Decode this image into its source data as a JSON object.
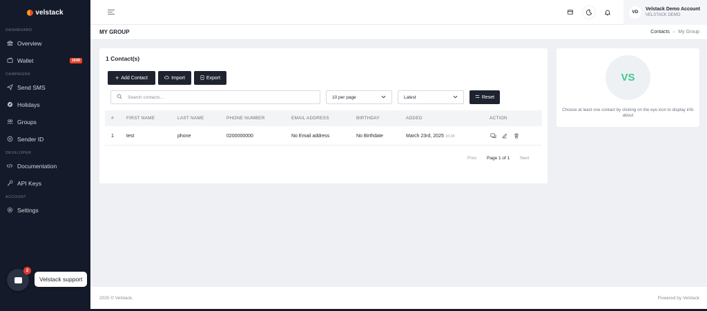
{
  "brand": {
    "name": "velstack",
    "accent": "#e8452c"
  },
  "sidebar": {
    "sections": [
      {
        "label": "DASHBOARD",
        "items": [
          {
            "label": "Overview",
            "icon": "bank-icon"
          },
          {
            "label": "Wallet",
            "icon": "wallet-icon",
            "badge": "1649"
          }
        ]
      },
      {
        "label": "CAMPAIGNS",
        "items": [
          {
            "label": "Send SMS",
            "icon": "send-icon"
          },
          {
            "label": "Holidays",
            "icon": "compass-icon"
          },
          {
            "label": "Groups",
            "icon": "users-icon"
          },
          {
            "label": "Sender ID",
            "icon": "target-icon"
          }
        ]
      },
      {
        "label": "DEVELOPER",
        "items": [
          {
            "label": "Documentation",
            "icon": "code-icon"
          },
          {
            "label": "API Keys",
            "icon": "key-icon"
          }
        ]
      },
      {
        "label": "ACCOUNT",
        "items": [
          {
            "label": "Settings",
            "icon": "gear-icon"
          }
        ]
      }
    ]
  },
  "header": {
    "icons": [
      "wallet-icon",
      "moon-icon",
      "bell-icon"
    ],
    "account": {
      "initials": "VD",
      "name": "Velstack Demo Account",
      "org": "VELSTACK DEMO"
    }
  },
  "page": {
    "title": "MY GROUP",
    "breadcrumb": [
      "Contacts",
      "My Group"
    ]
  },
  "contacts": {
    "count_label": "1 Contact(s)",
    "buttons": {
      "add": "Add Contact",
      "import": "Import",
      "export": "Export",
      "reset": "Reset"
    },
    "search_placeholder": "Search contacts...",
    "per_page": "10 per page",
    "sort": "Latest",
    "columns": [
      "#",
      "FIRST NAME",
      "LAST NAME",
      "PHONE NUMBER",
      "EMAIL ADDRESS",
      "BIRTHDAY",
      "ADDED",
      "ACTION"
    ],
    "rows": [
      {
        "index": "1",
        "first_name": "test",
        "last_name": "phone",
        "phone": "0200000000",
        "email": "No Email address",
        "birthday": "No Birthdate",
        "added_date": "March 23rd, 2025",
        "added_time": "10:28"
      }
    ],
    "pager": {
      "prev": "Prev",
      "page": "Page 1 of 1",
      "next": "Next"
    }
  },
  "info_panel": {
    "initials": "VS",
    "initials_color": "#3fc98a",
    "message": "Choose at least one contact by clicking on the eye icon to display info about"
  },
  "footer": {
    "left": "2025 © Velstack.",
    "right": "Powered by Velstack"
  },
  "chat": {
    "label": "Velstack support",
    "badge": "2"
  }
}
